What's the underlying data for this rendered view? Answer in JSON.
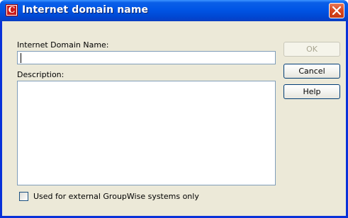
{
  "window": {
    "title": "Internet domain name",
    "app_icon_glyph": "C",
    "close_icon": "close-icon"
  },
  "form": {
    "domain_label": "Internet Domain Name:",
    "domain_value": "",
    "description_label": "Description:",
    "description_value": "",
    "external_checkbox_label": "Used for external GroupWise systems only",
    "external_checked": false
  },
  "buttons": {
    "ok_label": "OK",
    "ok_enabled": false,
    "cancel_label": "Cancel",
    "help_label": "Help"
  },
  "colors": {
    "titlebar": "#0055e5",
    "dialog_face": "#ece9d8",
    "close_button": "#d8461e",
    "input_border": "#7f9db9"
  }
}
